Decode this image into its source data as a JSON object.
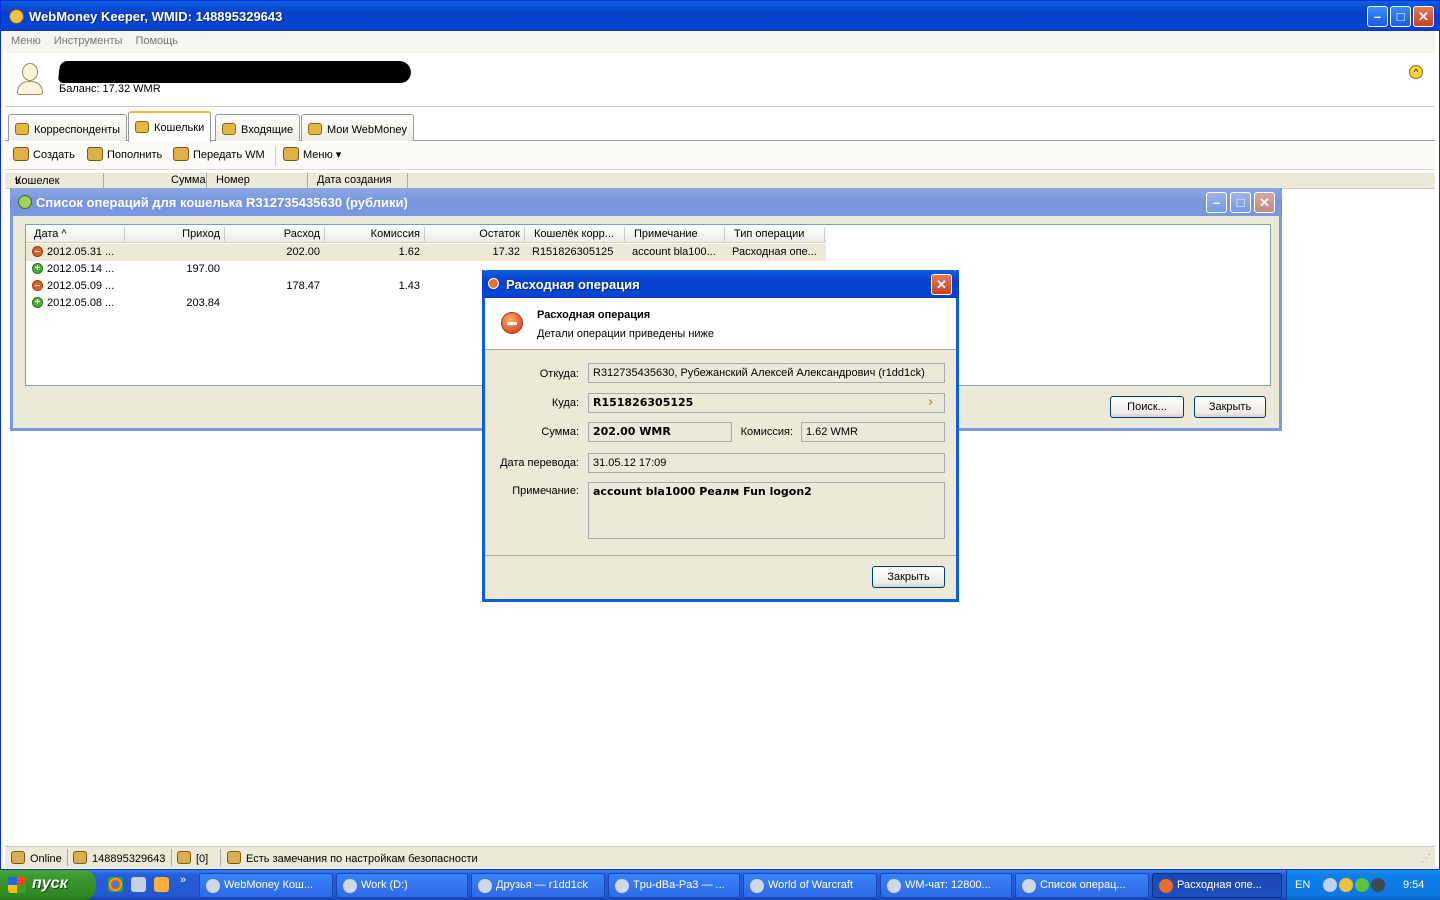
{
  "main_window": {
    "title": "WebMoney Keeper, WMID: 148895329643",
    "menu": [
      "Меню",
      "Инструменты",
      "Помощь"
    ],
    "balance": "Баланс: 17.32 WMR",
    "tabs": [
      "Корреспонденты",
      "Кошельки",
      "Входящие",
      "Мои WebMoney"
    ],
    "active_tab": "Кошельки",
    "toolbar": [
      "Создать",
      "Пополнить",
      "Передать WM",
      "Меню"
    ],
    "columns": [
      "Кошелек",
      "Сумма",
      "Номер",
      "Дата создания"
    ]
  },
  "status_bar": {
    "online": "Online",
    "wmid": "148895329643",
    "messages": "[0]",
    "security": "Есть замечания по настройкам безопасности"
  },
  "ops_window": {
    "title": "Список операций для кошелька R312735435630 (рублики)",
    "columns": [
      "Дата",
      "Приход",
      "Расход",
      "Комиссия",
      "Остаток",
      "Кошелёк корр...",
      "Примечание",
      "Тип операции"
    ],
    "rows": [
      {
        "date": "2012.05.31 ...",
        "income": "",
        "expense": "202.00",
        "fee": "1.62",
        "rest": "17.32",
        "wallet": "R151826305125",
        "note": "account bla100...",
        "type": "Расходная опе...",
        "kind": "out"
      },
      {
        "date": "2012.05.14 ...",
        "income": "197.00",
        "expense": "",
        "fee": "",
        "rest": "",
        "wallet": "",
        "note": "",
        "type": "",
        "kind": "in"
      },
      {
        "date": "2012.05.09 ...",
        "income": "",
        "expense": "178.47",
        "fee": "1.43",
        "rest": "",
        "wallet": "",
        "note": "",
        "type": "",
        "kind": "out"
      },
      {
        "date": "2012.05.08 ...",
        "income": "203.84",
        "expense": "",
        "fee": "",
        "rest": "",
        "wallet": "",
        "note": "",
        "type": "",
        "kind": "in"
      }
    ],
    "search_button": "Поиск...",
    "close_button": "Закрыть"
  },
  "dialog": {
    "title": "Расходная операция",
    "heading": "Расходная операция",
    "subheading": "Детали операции приведены ниже",
    "from_label": "Откуда:",
    "from_value": "R312735435630, Рубежанский Алексей Александрович (r1dd1ck)",
    "to_label": "Куда:",
    "to_value": "R151826305125",
    "amount_label": "Сумма:",
    "amount_value": "202.00 WMR",
    "fee_label": "Комиссия:",
    "fee_value": "1.62 WMR",
    "date_label": "Дата перевода:",
    "date_value": "31.05.12 17:09",
    "note_label": "Примечание:",
    "note_value": "account bla1000 Реалм Fun logon2",
    "close_button": "Закрыть"
  },
  "taskbar": {
    "start": "пуск",
    "items": [
      "WebMoney Кош...",
      "Work (D:)",
      "Друзья — r1dd1ck",
      "Tpu-dBa-Pa3 — ...",
      "World of Warcraft",
      "WM-чат: 12800...",
      "Список операц...",
      "Расходная опе..."
    ],
    "active_index": 7,
    "language": "EN",
    "clock": "9:54"
  }
}
